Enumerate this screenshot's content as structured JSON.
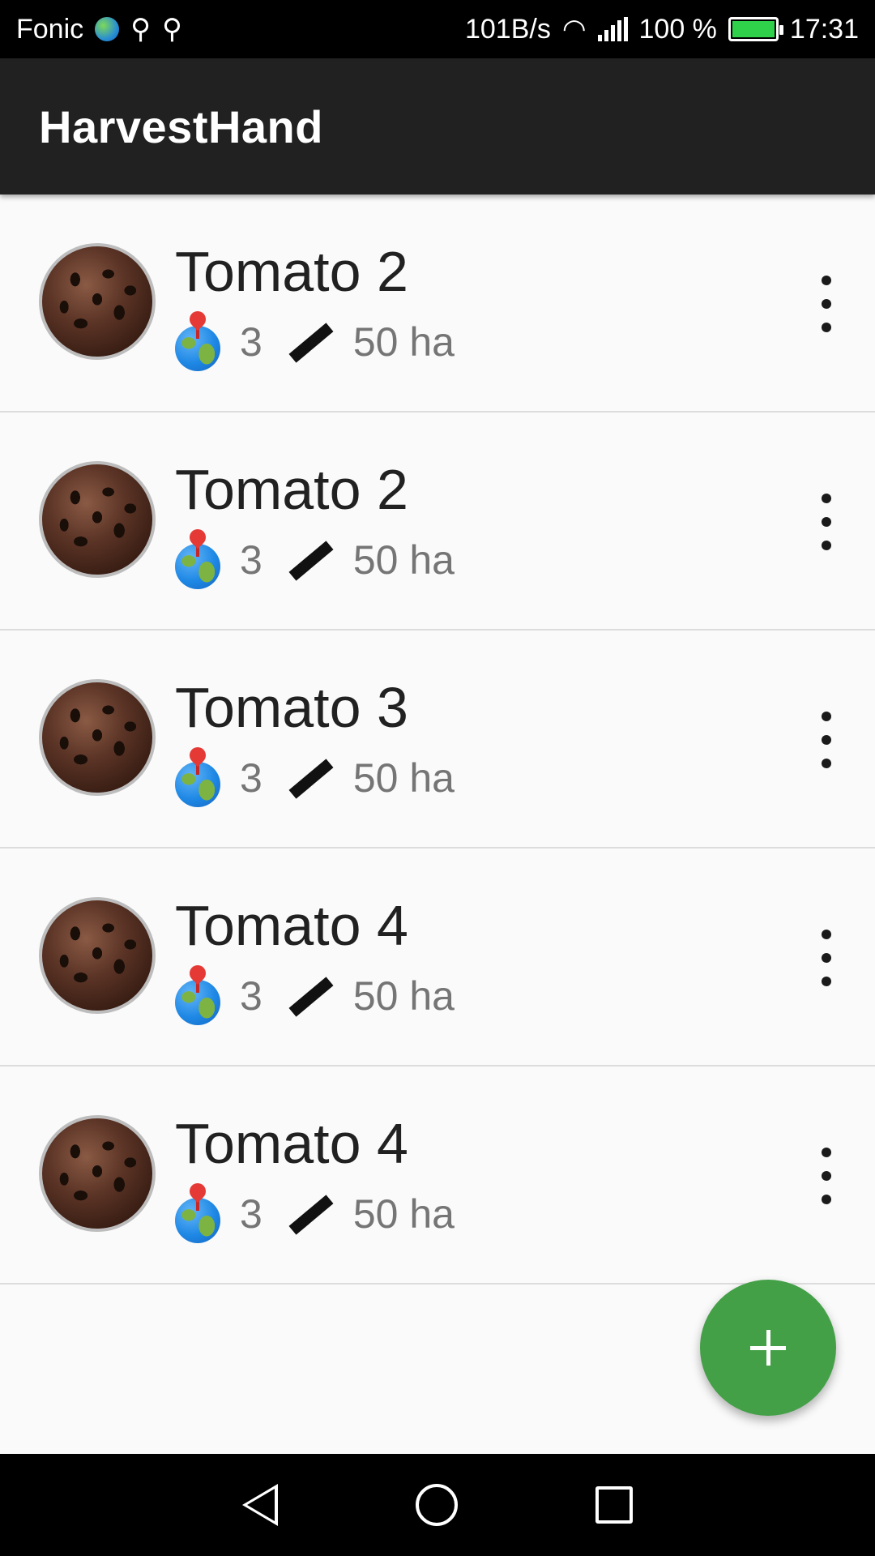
{
  "status_bar": {
    "carrier": "Fonic",
    "net_speed": "101B/s",
    "battery": "100 %",
    "time": "17:31",
    "icons": [
      "globe-icon",
      "usb-icon",
      "usb-icon",
      "wifi-icon",
      "signal-icon",
      "battery-icon"
    ]
  },
  "app_bar": {
    "title": "HarvestHand"
  },
  "fields": [
    {
      "name": "Tomato 2",
      "count": "3",
      "area": "50 ha"
    },
    {
      "name": "Tomato 2",
      "count": "3",
      "area": "50 ha"
    },
    {
      "name": "Tomato 3",
      "count": "3",
      "area": "50 ha"
    },
    {
      "name": "Tomato 4",
      "count": "3",
      "area": "50 ha"
    },
    {
      "name": "Tomato 4",
      "count": "3",
      "area": "50 ha"
    }
  ],
  "fab": {
    "icon": "plus-icon"
  },
  "colors": {
    "accent": "#43a047",
    "app_bar": "#212121",
    "status_bar": "#000000"
  },
  "navigation_bar": {
    "icons": [
      "back-icon",
      "home-icon",
      "recents-icon"
    ]
  }
}
